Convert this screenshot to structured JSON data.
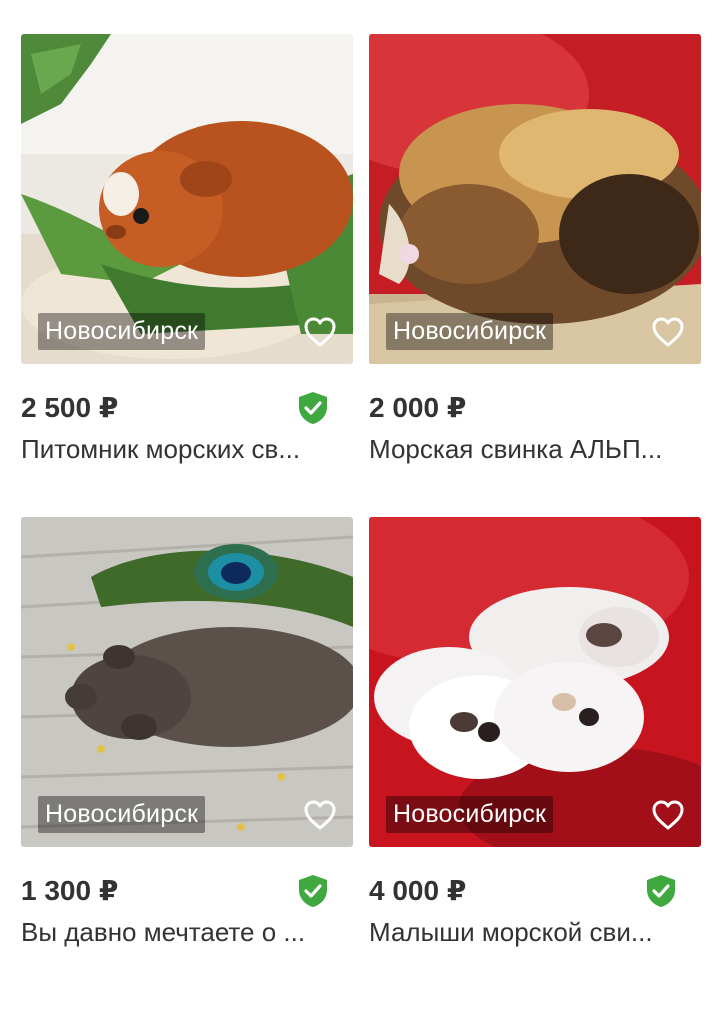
{
  "listings": [
    {
      "city": "Новосибирск",
      "price": "2 500 ₽",
      "title": "Питомник морских св...",
      "verified": true,
      "photo": "ginger-guinea-pig-on-sawdust",
      "favorite_icon": "heart-outline-icon"
    },
    {
      "city": "Новосибирск",
      "price": "2 000 ₽",
      "title": "Морская свинка АЛЬП...",
      "verified": false,
      "photo": "long-haired-alpaca-guinea-pig-on-red",
      "favorite_icon": "heart-outline-icon"
    },
    {
      "city": "Новосибирск",
      "price": "1 300 ₽",
      "title": "Вы давно мечтаете о ...",
      "verified": true,
      "photo": "hairless-skinny-guinea-pig-with-peacock-feather",
      "favorite_icon": "heart-outline-icon"
    },
    {
      "city": "Новосибирск",
      "price": "4 000 ₽",
      "title": "Малыши морской сви...",
      "verified": true,
      "photo": "white-guinea-pig-babies-on-red",
      "favorite_icon": "heart-outline-icon"
    }
  ],
  "colors": {
    "verified_badge": "#3fa83f",
    "text": "#333333",
    "city_overlay": "rgba(0,0,0,0.38)"
  }
}
